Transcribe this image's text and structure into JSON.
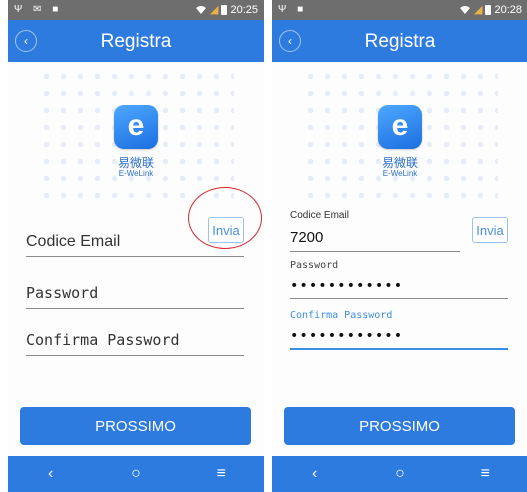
{
  "screens": [
    {
      "status": {
        "time": "20:25",
        "left_icons": "Ψ ✉ ■"
      },
      "header": {
        "title": "Registra"
      },
      "brand": {
        "cn": "易微联",
        "en": "E-WeLink"
      },
      "form": {
        "email_code_placeholder": "Codice Email",
        "password_placeholder": "Password",
        "confirm_placeholder": "Confirma Password",
        "send_button": "Invia"
      },
      "primary_button": "PROSSIMO"
    },
    {
      "status": {
        "time": "20:28",
        "left_icons": "Ψ ■"
      },
      "header": {
        "title": "Registra"
      },
      "brand": {
        "cn": "易微联",
        "en": "E-WeLink"
      },
      "form": {
        "email_code_label": "Codice Email",
        "email_code_value": "7200",
        "password_label": "Password",
        "password_value": "••••••••••••",
        "confirm_label": "Confirma Password",
        "confirm_value": "••••••••••••",
        "send_button": "Invia"
      },
      "primary_button": "PROSSIMO"
    }
  ],
  "navbar": {
    "back": "‹",
    "home": "○",
    "menu": "≡"
  },
  "colors": {
    "primary": "#2e7be0",
    "highlight": "#d6262a",
    "focus": "#3d8fe6"
  },
  "icons": [
    "back-arrow-icon",
    "wifi-icon",
    "signal-icon",
    "battery-icon",
    "e-welink-logo-icon",
    "nav-back-icon",
    "nav-home-icon",
    "nav-menu-icon"
  ]
}
